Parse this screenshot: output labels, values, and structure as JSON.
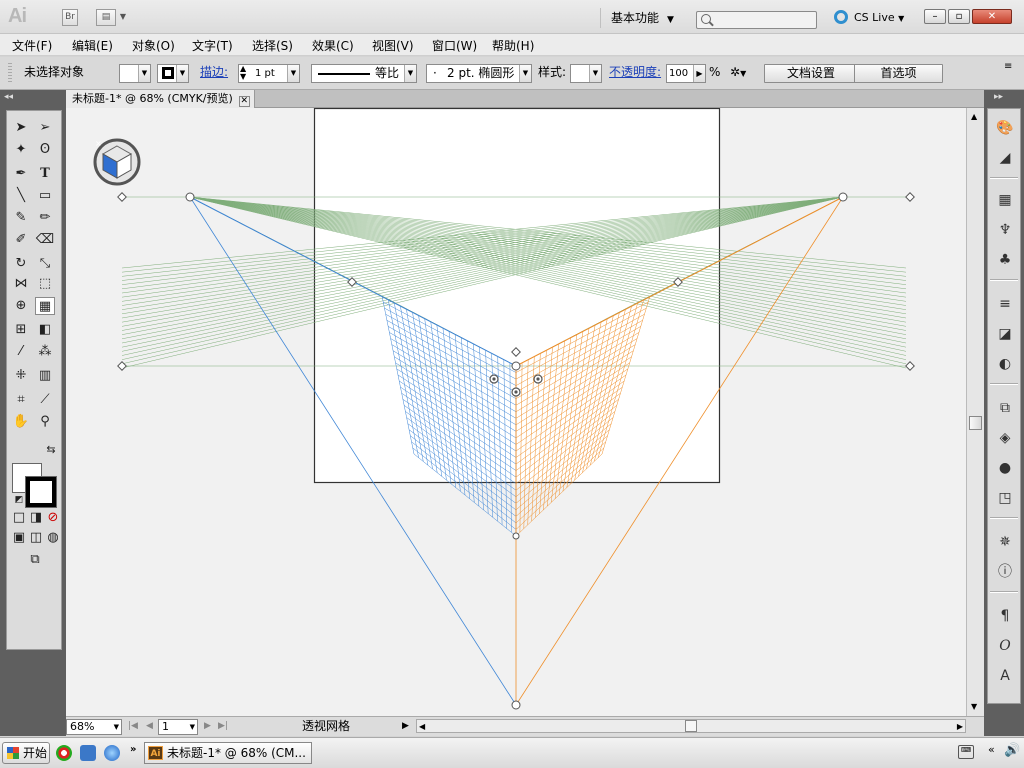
{
  "app": {
    "logo": "Ai",
    "bridge_label": "Br",
    "workspace": "基本功能",
    "cs_live": "CS Live",
    "search_placeholder": ""
  },
  "menu": [
    "文件(F)",
    "编辑(E)",
    "对象(O)",
    "文字(T)",
    "选择(S)",
    "效果(C)",
    "视图(V)",
    "窗口(W)",
    "帮助(H)"
  ],
  "control_bar": {
    "selection_state": "未选择对象",
    "stroke_label": "描边:",
    "stroke_weight": "1 pt",
    "stroke_profile": "等比",
    "brush": "2 pt. 椭圆形",
    "style_label": "样式:",
    "opacity_label": "不透明度:",
    "opacity_value": "100",
    "opacity_unit": "%",
    "doc_setup": "文档设置",
    "preferences": "首选项"
  },
  "document": {
    "tab_title": "未标题-1* @ 68% (CMYK/预览)"
  },
  "status_bar": {
    "zoom": "68%",
    "artboard": "1",
    "current_tool": "透视网格"
  },
  "taskbar": {
    "start": "开始",
    "task_item": "未标题-1* @ 68% (CM..."
  },
  "colors": {
    "left_grid": "#3f86d6",
    "right_grid": "#ef8f2b",
    "ground_grid": "#7fae7a",
    "artboard_border": "#333333"
  },
  "icons": {
    "perspective_widget": "perspective-cube-icon"
  }
}
